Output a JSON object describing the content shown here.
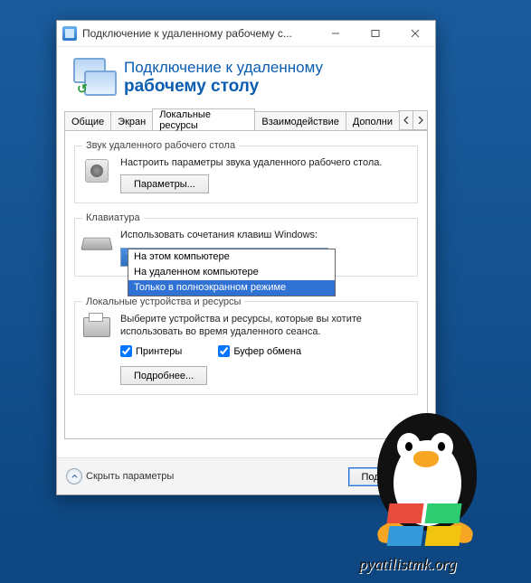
{
  "titlebar": {
    "text": "Подключение к удаленному рабочему с..."
  },
  "banner": {
    "line1": "Подключение к удаленному",
    "line2": "рабочему столу"
  },
  "tabs": {
    "items": [
      "Общие",
      "Экран",
      "Локальные ресурсы",
      "Взаимодействие",
      "Дополни"
    ],
    "active": 2
  },
  "audio": {
    "legend": "Звук удаленного рабочего стола",
    "desc": "Настроить параметры звука удаленного рабочего стола.",
    "button": "Параметры..."
  },
  "keyboard": {
    "legend": "Клавиатура",
    "desc": "Использовать сочетания клавиш Windows:",
    "selected": "Только в полноэкранном режиме",
    "options": [
      "На этом компьютере",
      "На удаленном компьютере",
      "Только в полноэкранном режиме"
    ],
    "highlighted": 2
  },
  "local": {
    "legend": "Локальные устройства и ресурсы",
    "desc": "Выберите устройства и ресурсы, которые вы хотите использовать во время удаленного сеанса.",
    "printers": "Принтеры",
    "clipboard": "Буфер обмена",
    "more": "Подробнее..."
  },
  "footer": {
    "hide": "Скрыть параметры",
    "connect": "Подключит"
  },
  "watermark": {
    "site": "pyatilistmk.org"
  }
}
